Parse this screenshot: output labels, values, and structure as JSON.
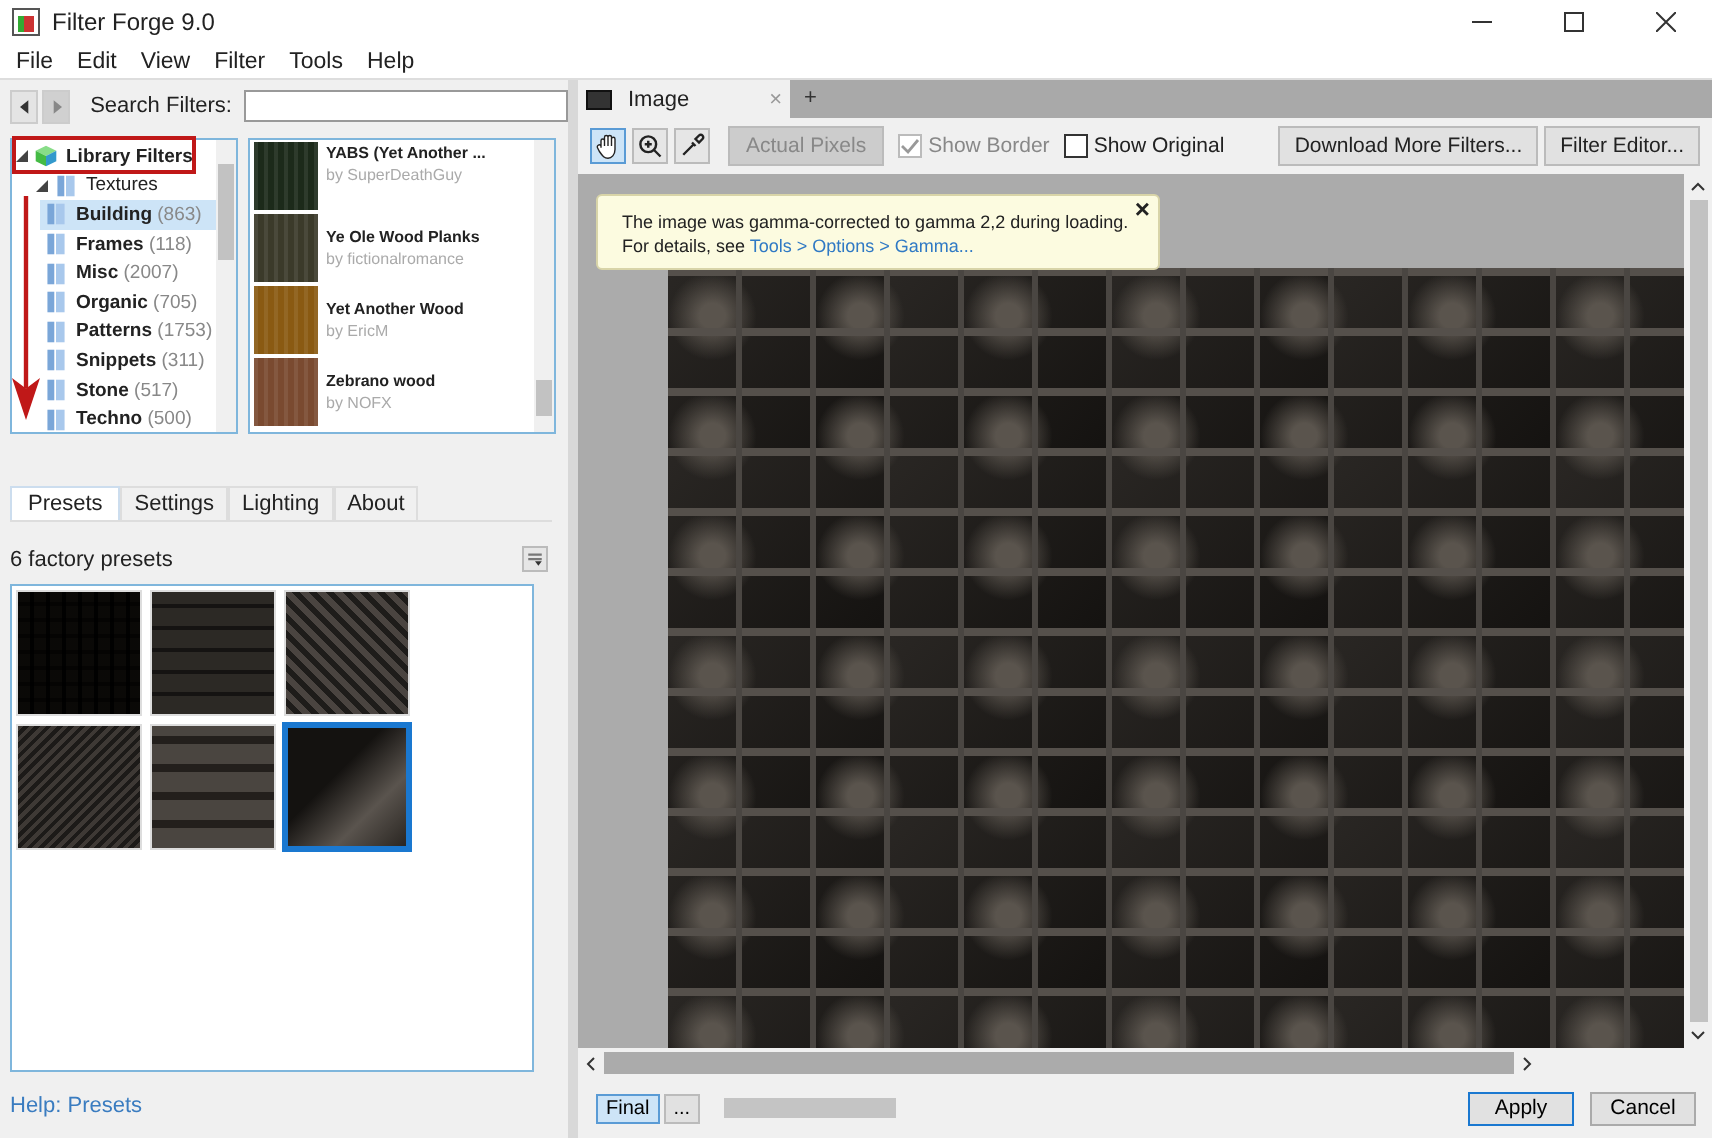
{
  "window": {
    "title": "Filter Forge 9.0"
  },
  "menu": [
    "File",
    "Edit",
    "View",
    "Filter",
    "Tools",
    "Help"
  ],
  "search": {
    "label": "Search Filters:"
  },
  "tree": [
    {
      "label": "Library Filters",
      "expanded": true,
      "children": [
        {
          "label": "Textures",
          "expanded": true,
          "children": [
            {
              "label": "Building",
              "count": "(863)",
              "selected": true
            },
            {
              "label": "Frames",
              "count": "(118)",
              "selected": false
            },
            {
              "label": "Misc",
              "count": "(2007)",
              "selected": false
            },
            {
              "label": "Organic",
              "count": "(705)",
              "selected": false
            },
            {
              "label": "Patterns",
              "count": "(1753)",
              "selected": false
            },
            {
              "label": "Snippets",
              "count": "(311)",
              "selected": false
            },
            {
              "label": "Stone",
              "count": "(517)",
              "selected": false
            },
            {
              "label": "Techno",
              "count": "(500)",
              "selected": false
            }
          ]
        }
      ]
    }
  ],
  "filters": [
    {
      "name": "YABS (Yet Another ...",
      "author": "by SuperDeathGuy"
    },
    {
      "name": "Ye Ole Wood Planks",
      "author": "by fictionalromance"
    },
    {
      "name": "Yet Another Wood",
      "author": "by EricM"
    },
    {
      "name": "Zebrano wood",
      "author": "by NOFX"
    }
  ],
  "tabs": [
    {
      "label": "Presets",
      "selected": true
    },
    {
      "label": "Settings",
      "selected": false
    },
    {
      "label": "Lighting",
      "selected": false
    },
    {
      "label": "About",
      "selected": false
    }
  ],
  "presets": {
    "count_label": "6 factory presets",
    "items": [
      {
        "selected": false
      },
      {
        "selected": false
      },
      {
        "selected": false
      },
      {
        "selected": false
      },
      {
        "selected": false
      },
      {
        "selected": true
      }
    ]
  },
  "help_link": "Help: Presets",
  "image_tab": {
    "title": "Image",
    "close": "×",
    "new": "+"
  },
  "tools": [
    {
      "kind": "hand",
      "selected": true
    },
    {
      "kind": "zoom",
      "selected": false
    },
    {
      "kind": "eyedropper",
      "selected": false
    }
  ],
  "actual_pixels": {
    "label": "Actual Pixels",
    "disabled": true
  },
  "show_border": {
    "label": "Show Border",
    "checked": true,
    "disabled": true
  },
  "show_original": {
    "label": "Show Original",
    "checked": false
  },
  "toolbar_buttons": [
    "Download More Filters...",
    "Filter Editor..."
  ],
  "notice": {
    "text": "The image was gamma-corrected to gamma 2,2 during loading.",
    "details": "For details, see ",
    "link": "Tools > Options > Gamma...",
    "close": "×"
  },
  "bottom": {
    "final": {
      "label": "Final",
      "selected": true
    },
    "more": "...",
    "progress": {
      "level": 1
    },
    "apply": "Apply",
    "cancel": "Cancel"
  }
}
